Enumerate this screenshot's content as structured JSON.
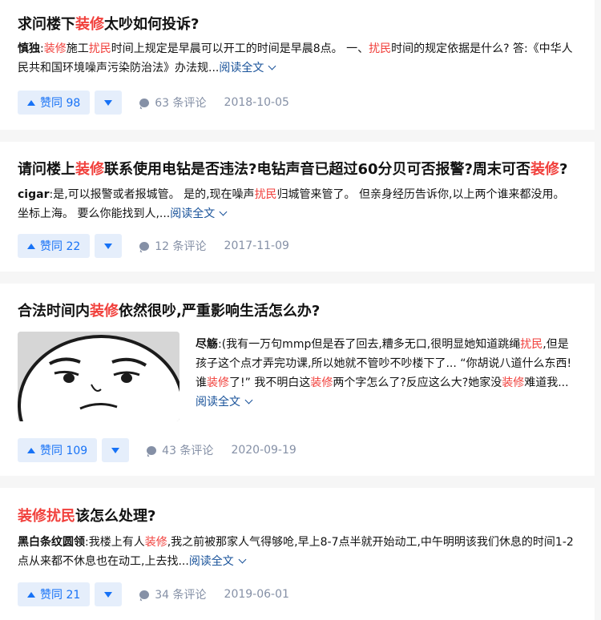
{
  "cards": [
    {
      "title": [
        {
          "t": "求问楼下",
          "hl": false
        },
        {
          "t": "装修",
          "hl": true
        },
        {
          "t": "太吵如何投诉?",
          "hl": false
        }
      ],
      "author": "慎独",
      "excerpt": [
        {
          "t": "装修",
          "hl": true
        },
        {
          "t": "施工",
          "hl": false
        },
        {
          "t": "扰民",
          "hl": true
        },
        {
          "t": "时间上规定是早晨可以开工的时间是早晨8点。 一、",
          "hl": false
        },
        {
          "t": "扰民",
          "hl": true
        },
        {
          "t": "时间的规定依据是什么? 答:《中华人民共和国环境噪声污染防治法》办法规...",
          "hl": false
        }
      ],
      "read_more": "阅读全文",
      "votes": "赞同 98",
      "comments": "63 条评论",
      "date": "2018-10-05"
    },
    {
      "title": [
        {
          "t": "请问楼上",
          "hl": false
        },
        {
          "t": "装修",
          "hl": true
        },
        {
          "t": "联系使用电钻是否违法?电钻声音已超过60分贝可否报警?周末可否",
          "hl": false
        },
        {
          "t": "装修",
          "hl": true
        },
        {
          "t": "?",
          "hl": false
        }
      ],
      "author": "cigar",
      "excerpt": [
        {
          "t": "是,可以报警或者报城管。 是的,现在噪声",
          "hl": false
        },
        {
          "t": "扰民",
          "hl": true
        },
        {
          "t": "归城管来管了。 但亲身经历告诉你,以上两个谁来都没用。 坐标上海。 要么你能找到人,...",
          "hl": false
        }
      ],
      "read_more": "阅读全文",
      "votes": "赞同 22",
      "comments": "12 条评论",
      "date": "2017-11-09"
    },
    {
      "title": [
        {
          "t": "合法时间内",
          "hl": false
        },
        {
          "t": "装修",
          "hl": true
        },
        {
          "t": "依然很吵,严重影响生活怎么办?",
          "hl": false
        }
      ],
      "author": "尽觞",
      "excerpt": [
        {
          "t": "(我有一万句mmp但是吞了回去,糟多无口,很明显她知道跳绳",
          "hl": false
        },
        {
          "t": "扰民",
          "hl": true
        },
        {
          "t": ",但是孩子这个点才弄完功课,所以她就不管吵不吵楼下了... “你胡说八道什么东西!谁",
          "hl": false
        },
        {
          "t": "装修",
          "hl": true
        },
        {
          "t": "了!” 我不明白这",
          "hl": false
        },
        {
          "t": "装修",
          "hl": true
        },
        {
          "t": "两个字怎么了?反应这么大?她家没",
          "hl": false
        },
        {
          "t": "装修",
          "hl": true
        },
        {
          "t": "难道我...",
          "hl": false
        }
      ],
      "read_more": "阅读全文",
      "votes": "赞同 109",
      "comments": "43 条评论",
      "date": "2020-09-19"
    },
    {
      "title": [
        {
          "t": "装修",
          "hl": true
        },
        {
          "t": "扰民",
          "hl": true
        },
        {
          "t": "该怎么处理?",
          "hl": false
        }
      ],
      "author": "黑白条纹圆领",
      "excerpt": [
        {
          "t": "我楼上有人",
          "hl": false
        },
        {
          "t": "装修",
          "hl": true
        },
        {
          "t": ",我之前被那家人气得够呛,早上8-7点半就开始动工,中午明明该我们休息的时间1-2点从来都不休息也在动工,上去找...",
          "hl": false
        }
      ],
      "read_more": "阅读全文",
      "votes": "赞同 21",
      "comments": "34 条评论",
      "date": "2019-06-01"
    }
  ],
  "colors": {
    "highlight": "#f1403c",
    "link": "#175199",
    "vote": "#1772f6",
    "vote_bg": "#e5eefb",
    "meta": "#8590a6"
  },
  "icons": [
    "caret-up-icon",
    "caret-down-icon",
    "comment-bubble-icon",
    "chevron-down-icon"
  ]
}
